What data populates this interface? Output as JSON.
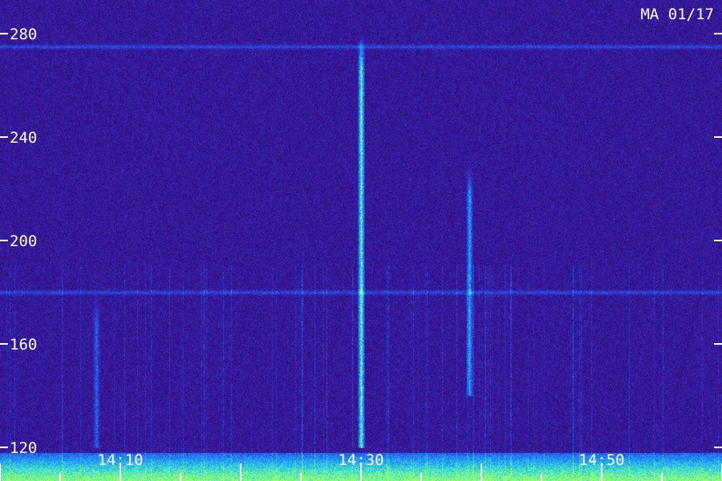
{
  "chart_data": {
    "type": "heatmap",
    "title": "",
    "station_label": "MA 01/17",
    "xlabel": "",
    "ylabel": "",
    "y_ticks": [
      120,
      160,
      200,
      240,
      280
    ],
    "y_tick_labels": [
      "120",
      "160",
      "200",
      "240",
      "280"
    ],
    "ylim": [
      107,
      293
    ],
    "x_labels": [
      "14:10",
      "14:30",
      "14:50"
    ],
    "x_minor_ticks_per_label": 2,
    "colormap": [
      "#1a0538",
      "#3a0f8a",
      "#2b3bd6",
      "#1f8fff",
      "#37e3d0",
      "#9cff6a"
    ],
    "background_color": "#1a0538",
    "burst_events": [
      {
        "time": "14:30",
        "freq_range": [
          120,
          280
        ],
        "intensity": "strong"
      },
      {
        "time": "14:39",
        "freq_range": [
          140,
          230
        ],
        "intensity": "moderate"
      },
      {
        "time": "14:08",
        "freq_range": [
          120,
          180
        ],
        "intensity": "weak"
      }
    ],
    "horizontal_bands": [
      180,
      275
    ],
    "noise_floor_freq_max": 118
  }
}
